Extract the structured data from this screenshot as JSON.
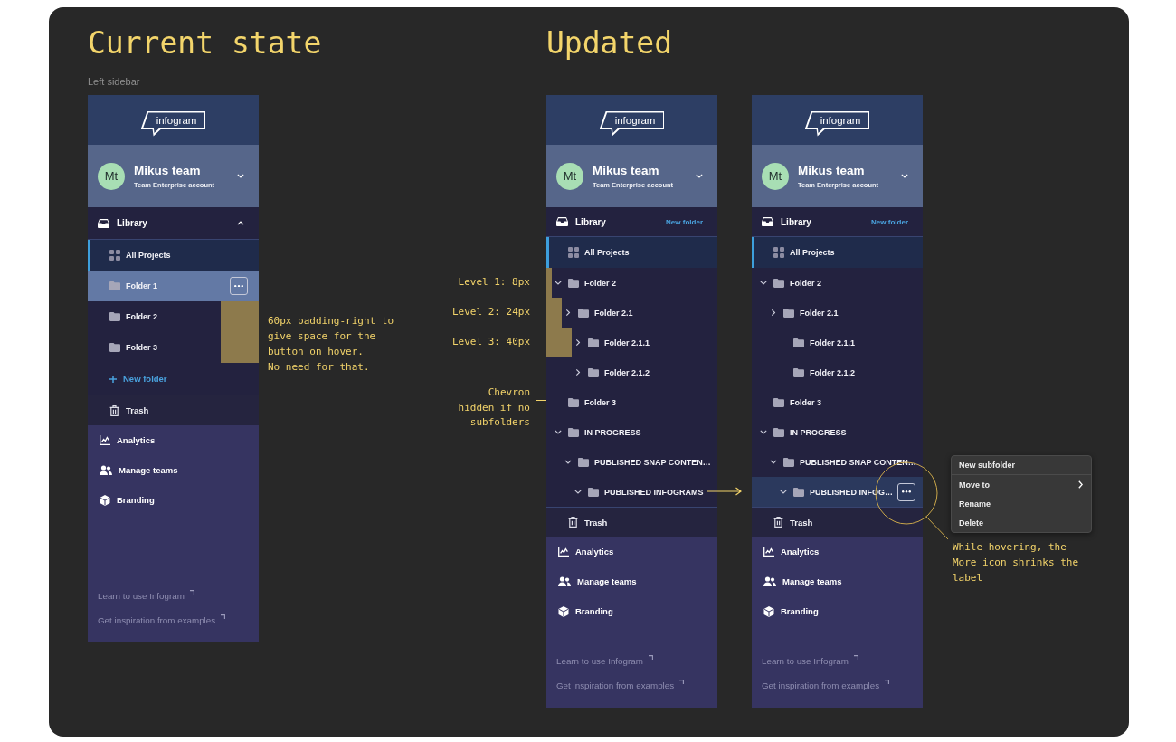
{
  "current": {
    "title": "Current state",
    "caption": "Left sidebar",
    "sidebar": {
      "kind": "flat",
      "logo": "infogram",
      "team": {
        "initials": "Mt",
        "name": "Mikus team",
        "plan": "Team Enterprise account"
      },
      "library": {
        "label": "Library",
        "expanded": true
      },
      "new_folder": {
        "label": "New folder",
        "kind": "row"
      },
      "items": [
        {
          "kind": "all",
          "label": "All Projects",
          "selected": true,
          "hovered": false,
          "marked": false
        },
        {
          "kind": "folder",
          "label": "Folder 1",
          "selected": false,
          "hovered": true,
          "marked": false
        },
        {
          "kind": "folder",
          "label": "Folder 2",
          "selected": false,
          "hovered": false,
          "marked": true
        },
        {
          "kind": "folder",
          "label": "Folder 3",
          "selected": false,
          "hovered": false,
          "marked": true
        }
      ],
      "trash": "Trash",
      "nav": [
        {
          "kind": "chart",
          "label": "Analytics"
        },
        {
          "kind": "people",
          "label": "Manage teams"
        },
        {
          "kind": "cube",
          "label": "Branding"
        }
      ],
      "links": [
        "Learn to use Infogram",
        "Get inspiration from examples"
      ]
    },
    "note": [
      "60px padding-right to give space for the button on hover.",
      "No need for that."
    ]
  },
  "updated": {
    "title": "Updated",
    "notes": [
      {
        "kind": "level",
        "text": "Level 1: 8px"
      },
      {
        "kind": "level",
        "text": "Level 2: 24px"
      },
      {
        "kind": "level",
        "text": "Level 3: 40px"
      },
      {
        "kind": "pointer",
        "text": "Chevron hidden if no subfolders"
      }
    ],
    "sidebars": [
      {
        "kind": "nested",
        "logo": "infogram",
        "team": {
          "initials": "Mt",
          "name": "Mikus team",
          "plan": "Team Enterprise account"
        },
        "library": {
          "label": "Library"
        },
        "new_folder": {
          "label": "New folder",
          "kind": "link"
        },
        "items": [
          {
            "kind": "all",
            "label": "All Projects",
            "selected": true,
            "hovered": false,
            "marked": false
          },
          {
            "kind": "folder",
            "label": "Folder 2",
            "selected": false,
            "hovered": false,
            "marked": true,
            "subfolders": true,
            "expanded": true,
            "children": [
              {
                "kind": "folder",
                "label": "Folder 2.1",
                "selected": false,
                "hovered": false,
                "marked": true,
                "subfolders": true,
                "expanded": false,
                "children": [
                  {
                    "kind": "folder",
                    "label": "Folder 2.1.1",
                    "selected": false,
                    "hovered": false,
                    "marked": true,
                    "subfolders": true,
                    "expanded": false
                  },
                  {
                    "kind": "folder",
                    "label": "Folder 2.1.2",
                    "selected": false,
                    "hovered": false,
                    "marked": false,
                    "subfolders": true,
                    "expanded": false
                  }
                ]
              }
            ]
          },
          {
            "kind": "folder",
            "label": "Folder 3",
            "selected": false,
            "hovered": false,
            "marked": false,
            "subfolders": false
          },
          {
            "kind": "folder",
            "label": "IN PROGRESS",
            "selected": false,
            "hovered": false,
            "marked": false,
            "subfolders": true,
            "expanded": true,
            "children": [
              {
                "kind": "folder",
                "label": "PUBLISHED SNAP CONTEN…",
                "selected": false,
                "hovered": false,
                "marked": false,
                "subfolders": true,
                "expanded": true,
                "children": [
                  {
                    "kind": "folder",
                    "label": "PUBLISHED INFOGRAMS",
                    "selected": false,
                    "hovered": false,
                    "marked": false,
                    "subfolders": true,
                    "expanded": true
                  }
                ]
              }
            ]
          }
        ],
        "trash": "Trash",
        "nav": [
          {
            "kind": "chart",
            "label": "Analytics"
          },
          {
            "kind": "people",
            "label": "Manage teams"
          },
          {
            "kind": "cube",
            "label": "Branding"
          }
        ],
        "links": [
          "Learn to use Infogram",
          "Get inspiration from examples"
        ]
      },
      {
        "kind": "nested",
        "logo": "infogram",
        "team": {
          "initials": "Mt",
          "name": "Mikus team",
          "plan": "Team Enterprise account"
        },
        "library": {
          "label": "Library"
        },
        "new_folder": {
          "label": "New folder",
          "kind": "link"
        },
        "items": [
          {
            "kind": "all",
            "label": "All Projects",
            "selected": true,
            "hovered": false,
            "marked": false
          },
          {
            "kind": "folder",
            "label": "Folder 2",
            "selected": false,
            "hovered": false,
            "marked": false,
            "subfolders": true,
            "expanded": true,
            "children": [
              {
                "kind": "folder",
                "label": "Folder 2.1",
                "selected": false,
                "hovered": false,
                "marked": false,
                "subfolders": true,
                "expanded": false,
                "children": [
                  {
                    "kind": "folder",
                    "label": "Folder 2.1.1",
                    "selected": false,
                    "hovered": false,
                    "marked": false,
                    "subfolders": false
                  },
                  {
                    "kind": "folder",
                    "label": "Folder 2.1.2",
                    "selected": false,
                    "hovered": false,
                    "marked": false,
                    "subfolders": false
                  }
                ]
              }
            ]
          },
          {
            "kind": "folder",
            "label": "Folder 3",
            "selected": false,
            "hovered": false,
            "marked": false,
            "subfolders": false
          },
          {
            "kind": "folder",
            "label": "IN PROGRESS",
            "selected": false,
            "hovered": false,
            "marked": false,
            "subfolders": true,
            "expanded": true,
            "children": [
              {
                "kind": "folder",
                "label": "PUBLISHED SNAP CONTEN…",
                "selected": false,
                "hovered": false,
                "marked": false,
                "subfolders": true,
                "expanded": true,
                "children": [
                  {
                    "kind": "folder",
                    "label": "PUBLISHED INFOG…",
                    "selected": false,
                    "hovered": true,
                    "marked": false,
                    "subfolders": true,
                    "expanded": true
                  }
                ]
              }
            ]
          }
        ],
        "trash": "Trash",
        "nav": [
          {
            "kind": "chart",
            "label": "Analytics"
          },
          {
            "kind": "people",
            "label": "Manage teams"
          },
          {
            "kind": "cube",
            "label": "Branding"
          }
        ],
        "links": [
          "Learn to use Infogram",
          "Get inspiration from examples"
        ]
      }
    ],
    "context_menu": [
      {
        "label": "New subfolder",
        "submenu": false,
        "divider_after": true
      },
      {
        "label": "Move to",
        "submenu": true,
        "divider_after": false
      },
      {
        "label": "Rename",
        "submenu": false,
        "divider_after": false
      },
      {
        "label": "Delete",
        "submenu": false,
        "divider_after": false
      }
    ],
    "note": "While hovering, the More icon shrinks the label"
  }
}
